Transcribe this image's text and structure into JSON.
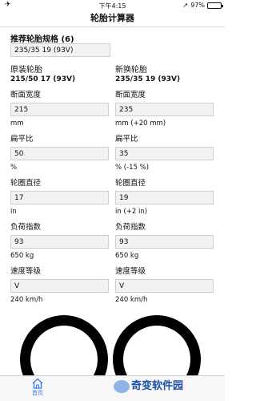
{
  "status_bar": {
    "time": "下午4:15",
    "battery_label": "97%",
    "battery_level": 0.97
  },
  "nav": {
    "title": "轮胎计算器"
  },
  "recommendation": {
    "label": "推荐轮胎规格 (6)",
    "value": "235/35 19 (93V)"
  },
  "original": {
    "title": "原装轮胎",
    "spec": "215/50 17 (93V)",
    "fields": [
      {
        "label": "断面宽度",
        "value": "215",
        "unit": "mm"
      },
      {
        "label": "扁平比",
        "value": "50",
        "unit": "%"
      },
      {
        "label": "轮圈直径",
        "value": "17",
        "unit": "in"
      },
      {
        "label": "负荷指数",
        "value": "93",
        "unit": "650 kg"
      },
      {
        "label": "速度等级",
        "value": "V",
        "unit": "240 km/h"
      }
    ]
  },
  "new": {
    "title": "新换轮胎",
    "spec": "235/35 19 (93V)",
    "fields": [
      {
        "label": "断面宽度",
        "value": "235",
        "unit": "mm (+20 mm)"
      },
      {
        "label": "扁平比",
        "value": "35",
        "unit": "% (-15 %)"
      },
      {
        "label": "轮圈直径",
        "value": "19",
        "unit": "in (+2 in)"
      },
      {
        "label": "负荷指数",
        "value": "93",
        "unit": "650 kg"
      },
      {
        "label": "速度等级",
        "value": "V",
        "unit": "240 km/h"
      }
    ]
  },
  "tabbar": {
    "home_label": "首页"
  },
  "watermark": {
    "text": "奇变软件园"
  },
  "colors": {
    "accent": "#3478f6",
    "field_bg": "#f2f2f2",
    "tire": "#000000"
  }
}
